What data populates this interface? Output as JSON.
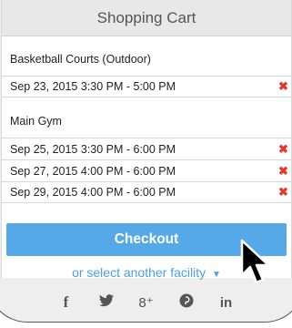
{
  "cart": {
    "title": "Shopping Cart",
    "groups": [
      {
        "facility": "Basketball Courts (Outdoor)",
        "slots": [
          "Sep 23, 2015 3:30 PM - 5:00 PM"
        ]
      },
      {
        "facility": "Main Gym",
        "slots": [
          "Sep 25, 2015 3:30 PM - 6:00 PM",
          "Sep 27, 2015 4:00 PM - 6:00 PM",
          "Sep 29, 2015 4:00 PM - 6:00 PM"
        ]
      }
    ],
    "remove_glyph": "✖",
    "checkout_label": "Checkout",
    "facility_link": "or select another facility",
    "facility_caret": "▼"
  },
  "social": {
    "facebook": "f",
    "twitter": "🐦",
    "googleplus": "8⁺",
    "pinterest": "℗",
    "linkedin": "in"
  },
  "colors": {
    "accent": "#56a9e8",
    "remove": "#e33a2f",
    "link": "#4a9fe0"
  }
}
